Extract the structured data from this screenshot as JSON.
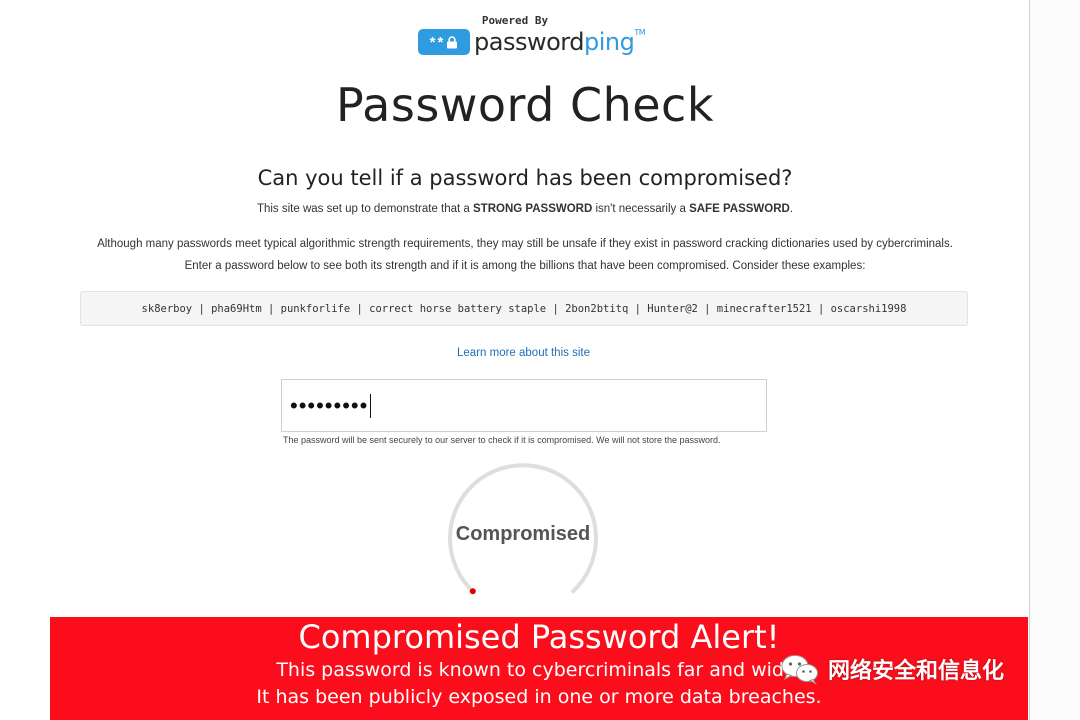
{
  "header": {
    "powered_by": "Powered By",
    "brand_prefix": "password",
    "brand_suffix": "ping",
    "brand_mark": "TM",
    "brand_color": "#2f9be0"
  },
  "main": {
    "title": "Password Check",
    "question": "Can you tell if a password has been compromised?",
    "intro": {
      "before": "This site was set up to demonstrate that a ",
      "strong": "STRONG PASSWORD",
      "middle": " isn't necessarily a ",
      "safe": "SAFE PASSWORD",
      "after": "."
    },
    "description_line1": "Although many passwords meet typical algorithmic strength requirements, they may still be unsafe if they exist in password cracking dictionaries used by cybercriminals.",
    "description_line2": "Enter a password below to see both its strength and if it is among the billions that have been compromised. Consider these examples:",
    "examples": "sk8erboy | pha69Htm | punkforlife | correct horse battery staple | 2bon2btitq | Hunter@2 | minecrafter1521 | oscarshi1998",
    "learn_more_link": "Learn more about this site"
  },
  "password_field": {
    "masked_value": "•••••••••",
    "note": "The password will be sent securely to our server to check if it is compromised. We will not store the password."
  },
  "gauge": {
    "status_label": "Compromised",
    "indicator_color": "#e00000"
  },
  "alert": {
    "title": "Compromised Password Alert!",
    "line1": "This password is known to cybercriminals far and wide.",
    "line2": "It has been publicly exposed in one or more data breaches.",
    "color": "#fc0d1b"
  },
  "watermark": {
    "icon": "wechat-icon",
    "text": "网络安全和信息化"
  }
}
